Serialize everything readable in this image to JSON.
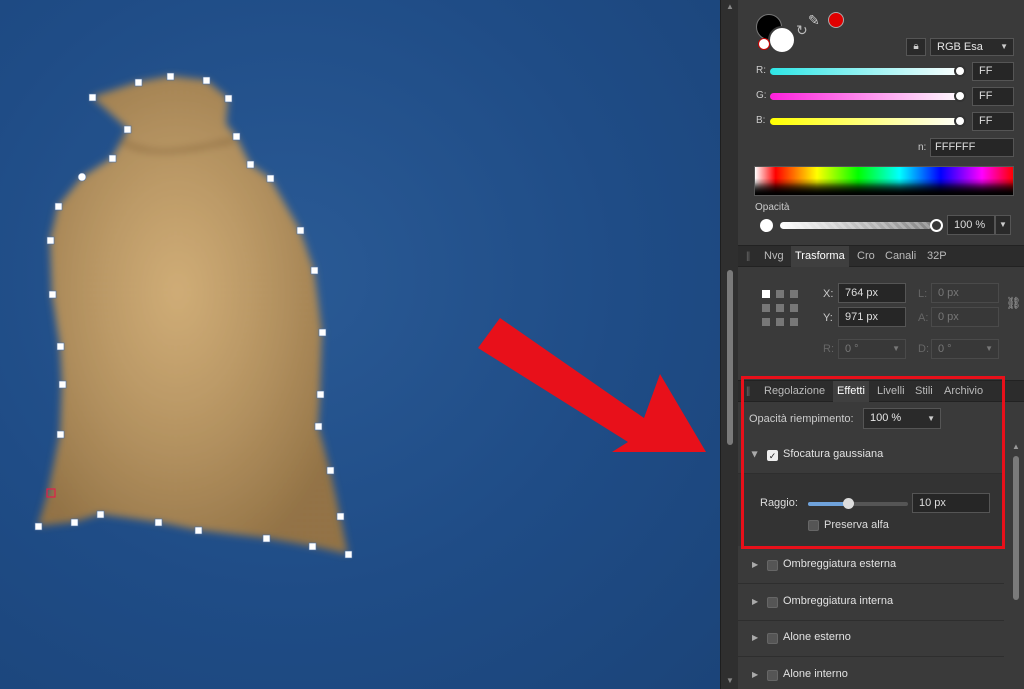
{
  "color": {
    "mode": "RGB Esa",
    "r_label": "R:",
    "r_value": "FF",
    "g_label": "G:",
    "g_value": "FF",
    "b_label": "B:",
    "b_value": "FF",
    "hex_label": "n:",
    "hex_value": "FFFFFF",
    "opacity_label": "Opacità",
    "opacity_value": "100 %",
    "primary": "#ffffff",
    "secondary": "#000000",
    "accent": "#e00000"
  },
  "tabs1": [
    {
      "label": "Nvg"
    },
    {
      "label": "Trasforma"
    },
    {
      "label": "Cro"
    },
    {
      "label": "Canali"
    },
    {
      "label": "32P"
    }
  ],
  "transform": {
    "x_label": "X:",
    "x_value": "764 px",
    "y_label": "Y:",
    "y_value": "971 px",
    "w_label": "L:",
    "w_value": "0 px",
    "h_label": "A:",
    "h_value": "0 px",
    "r_label": "R:",
    "r_value": "0 °",
    "s_label": "D:",
    "s_value": "0 °"
  },
  "tabs2": [
    {
      "label": "Regolazione"
    },
    {
      "label": "Effetti"
    },
    {
      "label": "Livelli"
    },
    {
      "label": "Stili"
    },
    {
      "label": "Archivio"
    }
  ],
  "effects": {
    "fill_opacity_label": "Opacità riempimento:",
    "fill_opacity_value": "100 %",
    "gaussian": {
      "label": "Sfocatura gaussiana",
      "checked": true,
      "radius_label": "Raggio:",
      "radius_value": "10 px",
      "radius_fraction": 0.4,
      "preserve_alpha_label": "Preserva alfa"
    },
    "items": [
      {
        "label": "Ombreggiatura esterna"
      },
      {
        "label": "Ombreggiatura interna"
      },
      {
        "label": "Alone esterno"
      },
      {
        "label": "Alone interno"
      }
    ]
  },
  "annotation": {
    "arrow_color": "#e8101a",
    "highlight_color": "#e8101a"
  },
  "icons": [
    "swap-colors-icon",
    "no-fill-icon",
    "color-picker-icon",
    "lock-icon",
    "anchor-grid-icon",
    "chain-link-icon",
    "disclosure-triangle-icon"
  ]
}
